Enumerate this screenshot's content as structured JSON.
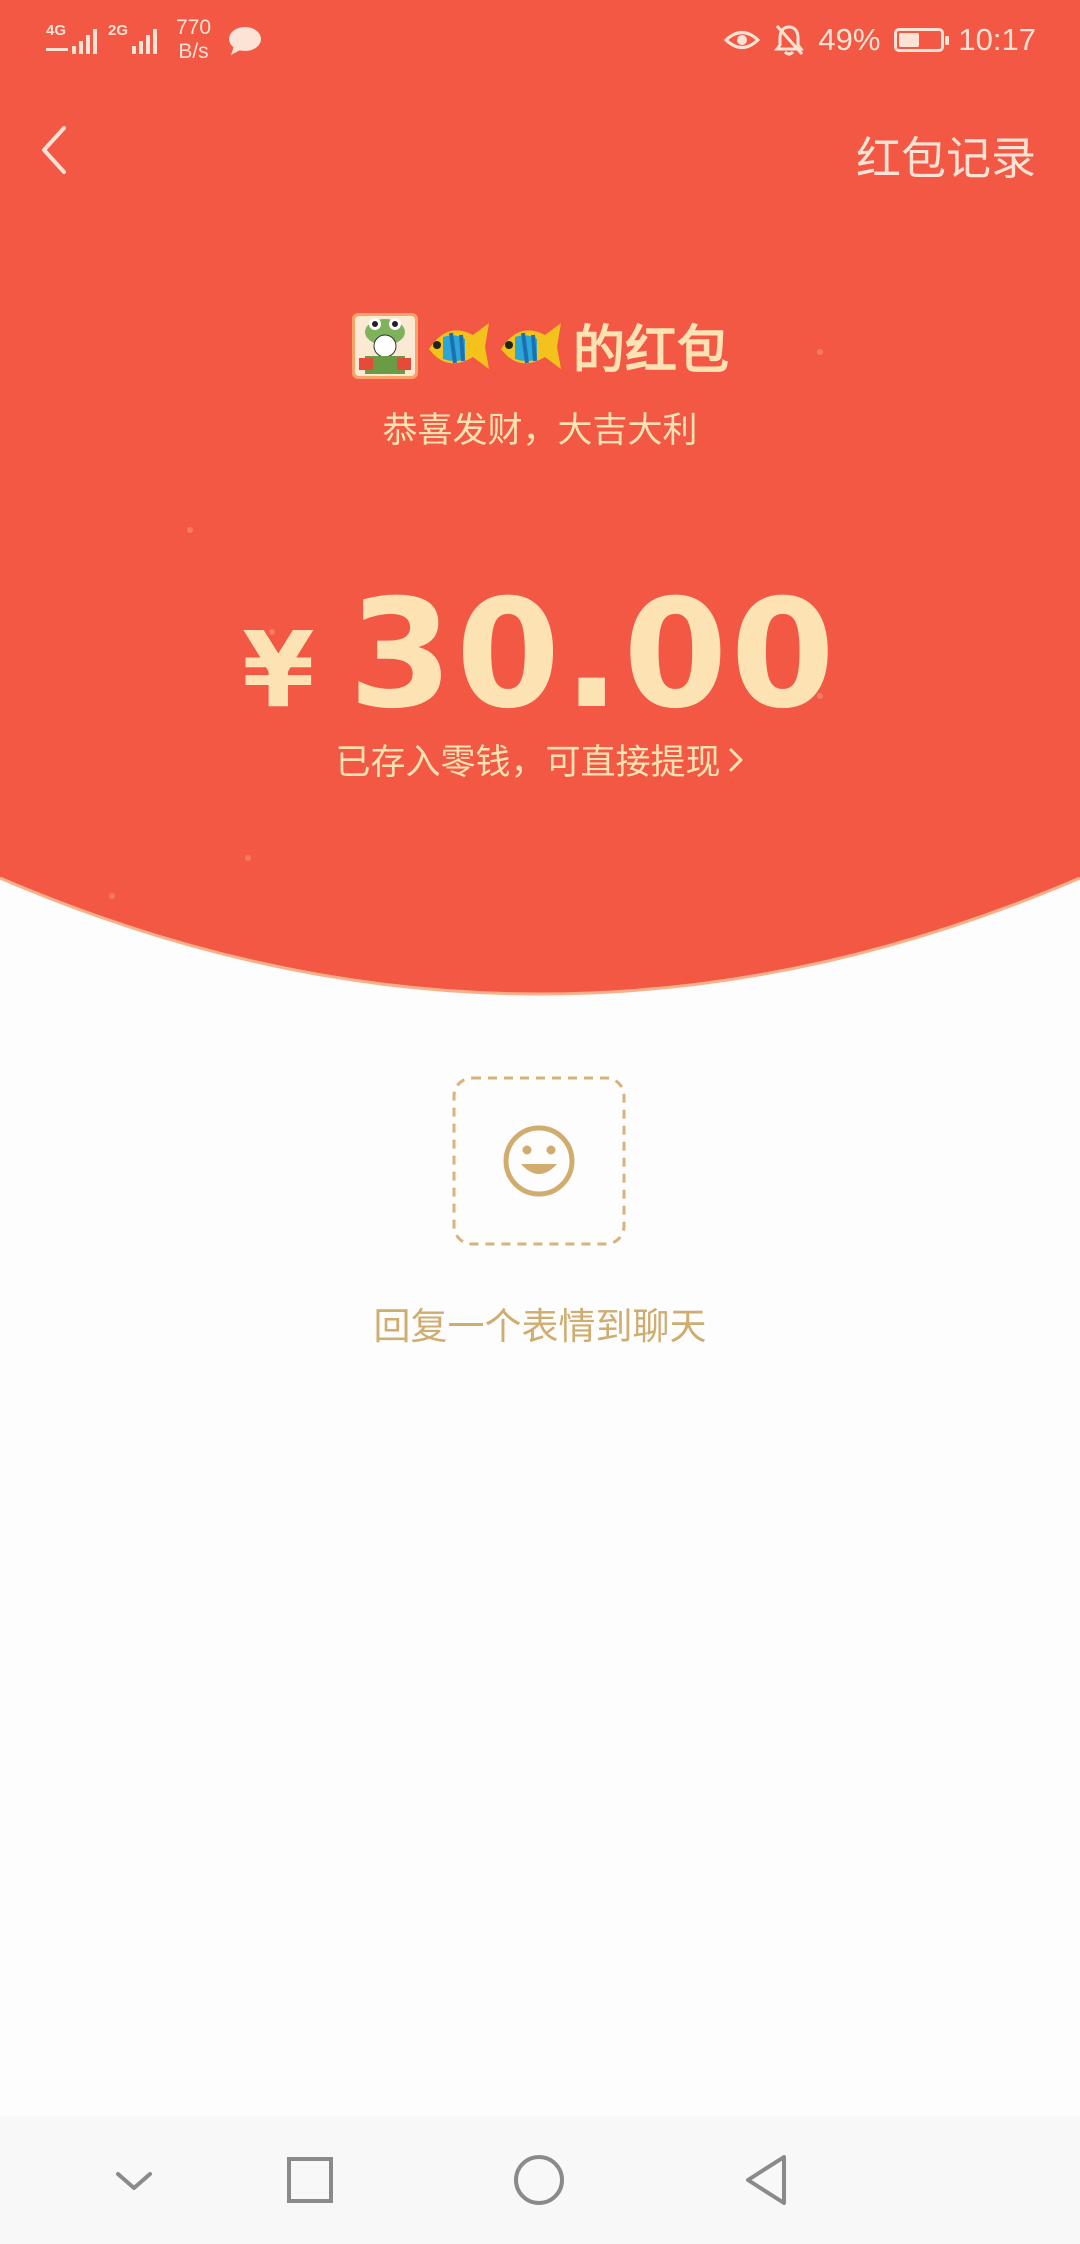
{
  "status_bar": {
    "signal_1": "4G",
    "signal_2": "2G",
    "net_speed_value": "770",
    "net_speed_unit": "B/s",
    "battery_percent": "49%",
    "battery_level": 0.49,
    "time": "10:17"
  },
  "header": {
    "records_label": "红包记录"
  },
  "envelope": {
    "sender_label": "的红包",
    "blessing": "恭喜发财，大吉大利",
    "currency_symbol": "¥",
    "amount": "30.00",
    "deposit_note": "已存入零钱，可直接提现"
  },
  "reply": {
    "label": "回复一个表情到聊天"
  },
  "colors": {
    "header_red": "#f25843",
    "gold_text": "#fde3b4",
    "reply_gold": "#cfac6f",
    "page_bg": "#fdfdfd"
  },
  "icons": [
    "back-arrow-icon",
    "avatar-icon",
    "fish-emoji",
    "smile-face-icon",
    "chevron-right-icon",
    "nav-down-icon",
    "nav-square-icon",
    "nav-circle-icon",
    "nav-back-icon"
  ]
}
